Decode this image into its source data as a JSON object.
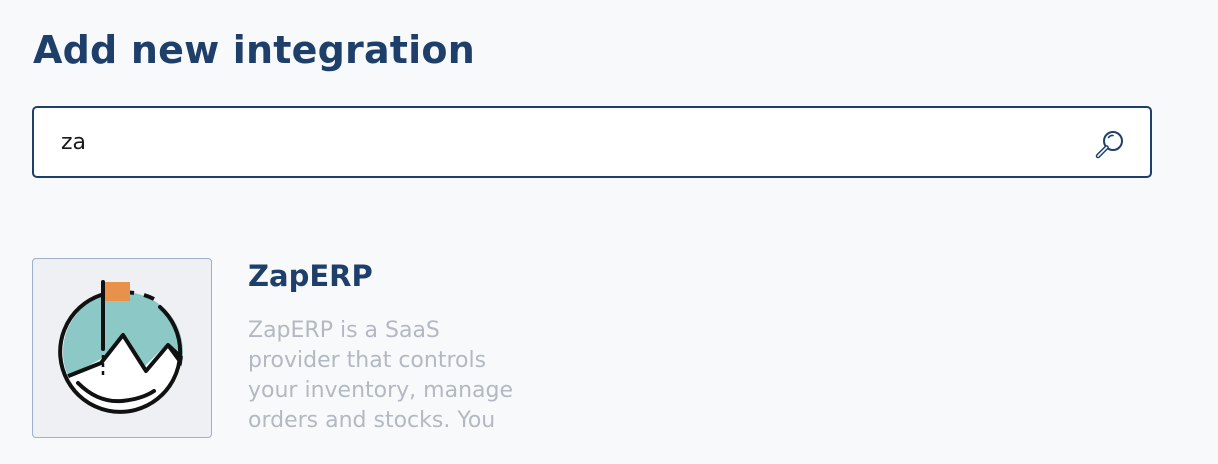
{
  "page": {
    "title": "Add new integration"
  },
  "search": {
    "value": "za",
    "icon": "search-icon"
  },
  "results": [
    {
      "name": "ZapERP",
      "description": "ZapERP is a SaaS\nprovider that controls\nyour inventory, manage\norders and stocks. You",
      "logo": "zaperp-mountain-flag-logo",
      "colors": {
        "sky": "#8cc8c5",
        "flag": "#e8914a",
        "outline": "#111111"
      }
    }
  ],
  "colors": {
    "heading": "#1f3f6b",
    "border": "#1f3f6b",
    "description": "#b3b9c2",
    "background": "#f8f9fb"
  }
}
